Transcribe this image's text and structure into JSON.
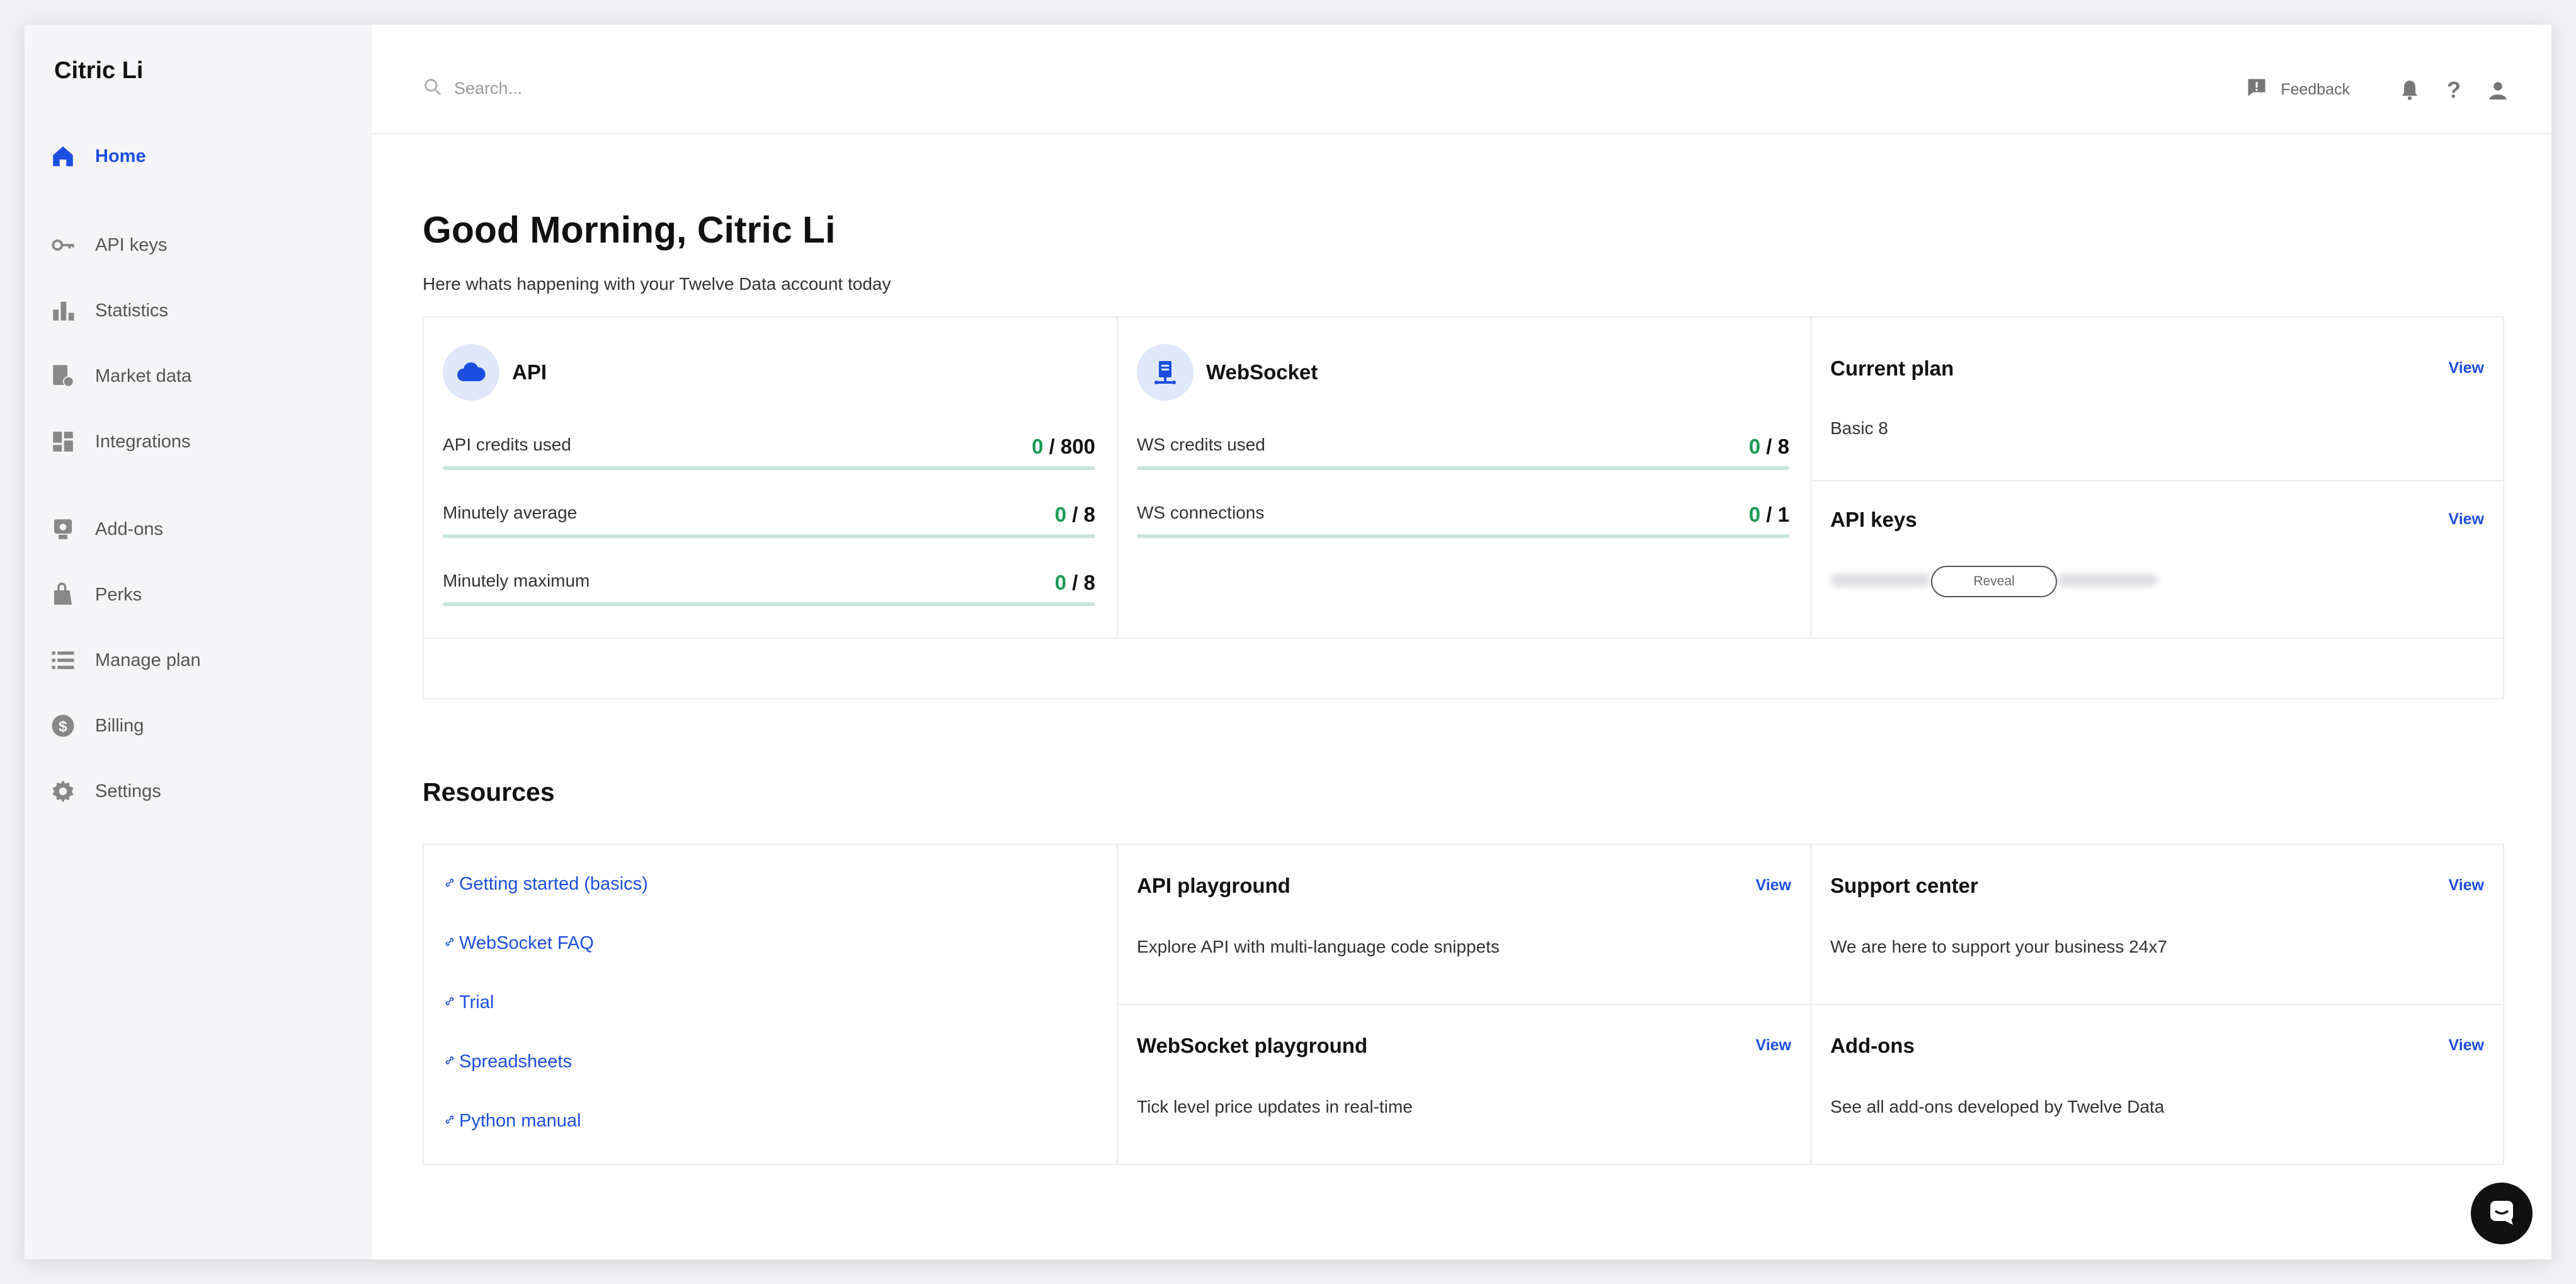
{
  "sidebar": {
    "brand": "Citric Li",
    "items": [
      {
        "label": "Home",
        "icon": "home-icon",
        "active": true
      },
      {
        "label": "API keys",
        "icon": "key-icon"
      },
      {
        "label": "Statistics",
        "icon": "bar-chart-icon"
      },
      {
        "label": "Market data",
        "icon": "market-data-icon"
      },
      {
        "label": "Integrations",
        "icon": "grid-icon"
      },
      {
        "label": "Add-ons",
        "icon": "add-ons-icon"
      },
      {
        "label": "Perks",
        "icon": "perks-icon"
      },
      {
        "label": "Manage plan",
        "icon": "list-icon"
      },
      {
        "label": "Billing",
        "icon": "dollar-icon"
      },
      {
        "label": "Settings",
        "icon": "gear-icon"
      }
    ]
  },
  "topbar": {
    "search_placeholder": "Search...",
    "feedback_label": "Feedback",
    "help_label": "?"
  },
  "greeting": {
    "title": "Good Morning, Citric Li",
    "subtitle": "Here whats happening with your Twelve Data account today"
  },
  "api_panel": {
    "title": "API",
    "metrics": [
      {
        "label": "API credits used",
        "used": "0",
        "total": " / 800",
        "fill": 0
      },
      {
        "label": "Minutely average",
        "used": "0",
        "total": " / 8",
        "fill": 0
      },
      {
        "label": "Minutely maximum",
        "used": "0",
        "total": " / 8",
        "fill": 0
      }
    ]
  },
  "ws_panel": {
    "title": "WebSocket",
    "metrics": [
      {
        "label": "WS credits used",
        "used": "0",
        "total": " / 8",
        "fill": 0
      },
      {
        "label": "WS connections",
        "used": "0",
        "total": " / 1",
        "fill": 0
      }
    ]
  },
  "plan_card": {
    "title": "Current plan",
    "link": "View",
    "value": "Basic 8"
  },
  "keys_card": {
    "title": "API keys",
    "link": "View",
    "reveal_label": "Reveal"
  },
  "resources": {
    "title": "Resources",
    "links": [
      "Getting started (basics)",
      "WebSocket FAQ",
      "Trial",
      "Spreadsheets",
      "Python manual"
    ],
    "cards": [
      {
        "title": "API playground",
        "link": "View",
        "text": "Explore API with multi-language code snippets"
      },
      {
        "title": "Support center",
        "link": "View",
        "text": "We are here to support your business 24x7"
      },
      {
        "title": "WebSocket playground",
        "link": "View",
        "text": "Tick level price updates in real-time"
      },
      {
        "title": "Add-ons",
        "link": "View",
        "text": "See all add-ons developed by Twelve Data"
      }
    ]
  },
  "colors": {
    "accent": "#1c4fe0",
    "success": "#1b9a56",
    "sidebar_bg": "#f5f5f7"
  }
}
